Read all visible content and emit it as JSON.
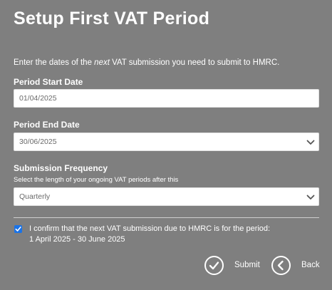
{
  "title": "Setup First VAT Period",
  "intro": {
    "before": "Enter the dates of the ",
    "emph": "next",
    "after": " VAT submission you need to submit to HMRC."
  },
  "period_start": {
    "label": "Period Start Date",
    "value": "01/04/2025"
  },
  "period_end": {
    "label": "Period End Date",
    "value": "30/06/2025"
  },
  "frequency": {
    "label": "Submission Frequency",
    "help": "Select the length of your ongoing VAT periods after this",
    "value": "Quarterly"
  },
  "confirm": {
    "checked": true,
    "line1": "I confirm that the next VAT submission due to HMRC is for the period:",
    "line2": "1 April 2025 - 30 June 2025"
  },
  "actions": {
    "submit_label": "Submit",
    "back_label": "Back"
  },
  "colors": {
    "background": "#7f7f7f",
    "checkbox": "#1a73e8"
  },
  "icons": {
    "submit": "checkmark-circle-icon",
    "back": "chevron-left-circle-icon",
    "dropdown": "chevron-down-icon"
  }
}
